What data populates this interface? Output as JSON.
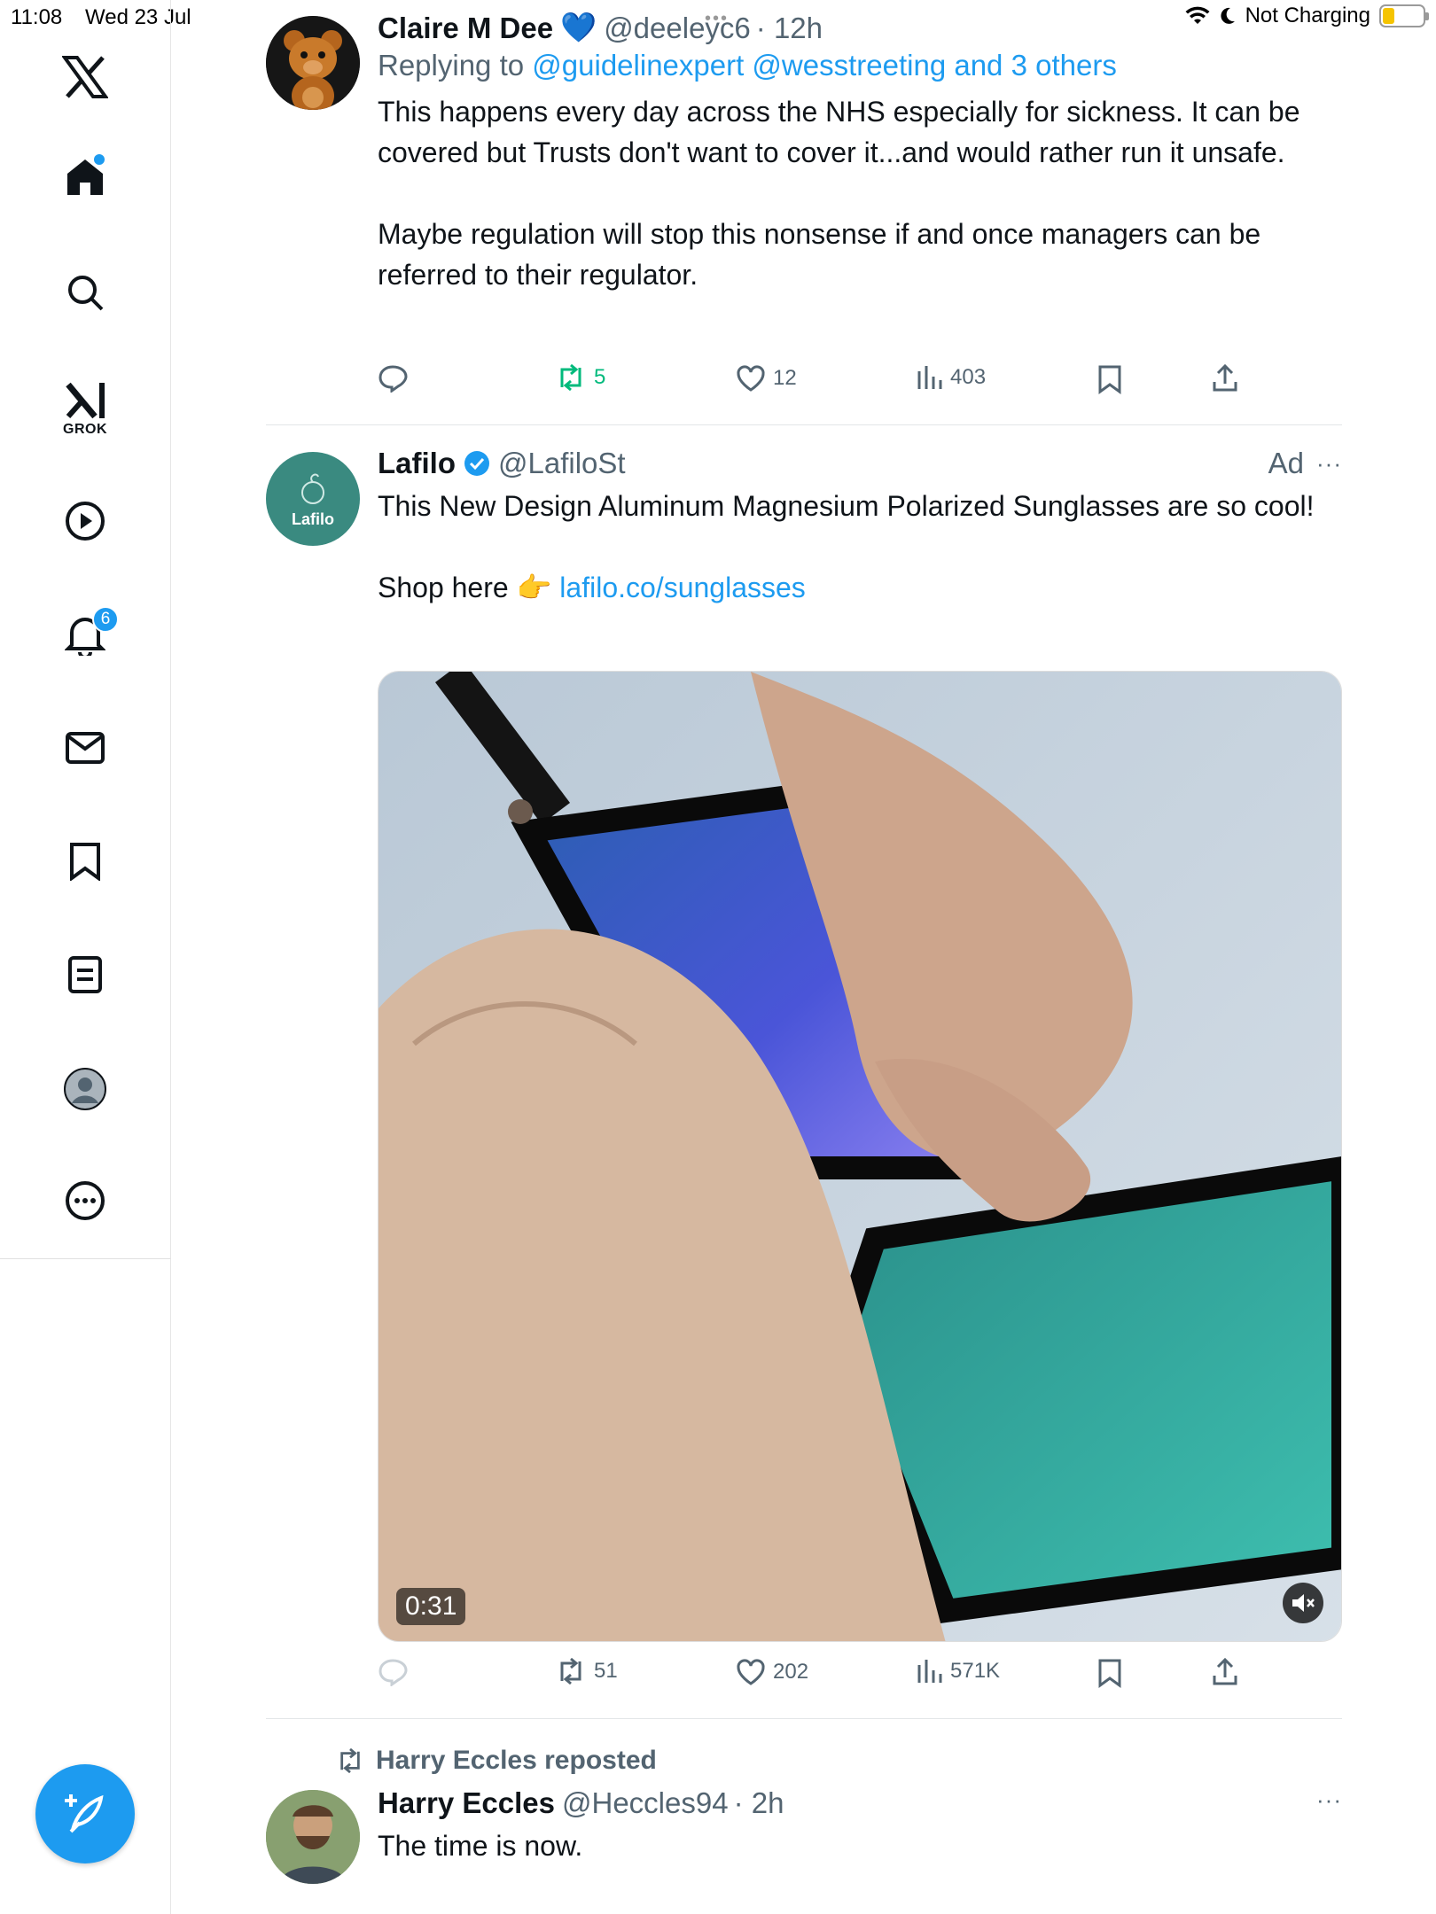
{
  "status_bar": {
    "time": "11:08",
    "date": "Wed 23 Jul",
    "charging": "Not Charging",
    "battery_color": "#f5c400"
  },
  "sidebar": {
    "grok_label": "GROK",
    "notification_count": "6",
    "items": [
      "x-logo-icon",
      "home-icon",
      "search-icon",
      "grok-icon",
      "video-icon",
      "notifications-icon",
      "messages-icon",
      "bookmarks-icon",
      "lists-icon",
      "profile-icon",
      "more-icon"
    ],
    "accent": "#1d9bf0"
  },
  "tweets": [
    {
      "name": "Claire M Dee",
      "handle": "@deeleyc6",
      "time": "· 12h",
      "replying_prefix": "Replying to",
      "replying_to": "@guidelinexpert @wesstreeting and 3 others",
      "text_p1": "This happens every day across the NHS especially for sickness. It can be covered but Trusts don't want to cover it...and would rather run it unsafe.",
      "text_p2": "Maybe regulation will stop this nonsense if and once managers can be referred to their regulator.",
      "reposts": "5",
      "likes": "12",
      "views": "403"
    },
    {
      "name": "Lafilo",
      "handle": "@LafiloSt",
      "ad_label": "Ad",
      "avatar_text": "Lafilo",
      "text_p1": "This New Design Aluminum Magnesium Polarized Sunglasses are so cool!",
      "shop_prefix": "Shop here 👉",
      "link": "lafilo.co/sunglasses",
      "video_duration": "0:31",
      "reposts": "51",
      "likes": "202",
      "views": "571K"
    },
    {
      "repost_label": "Harry Eccles reposted",
      "name": "Harry Eccles",
      "handle": "@Heccles94",
      "time": "· 2h",
      "text_p1": "The time is now."
    }
  ]
}
